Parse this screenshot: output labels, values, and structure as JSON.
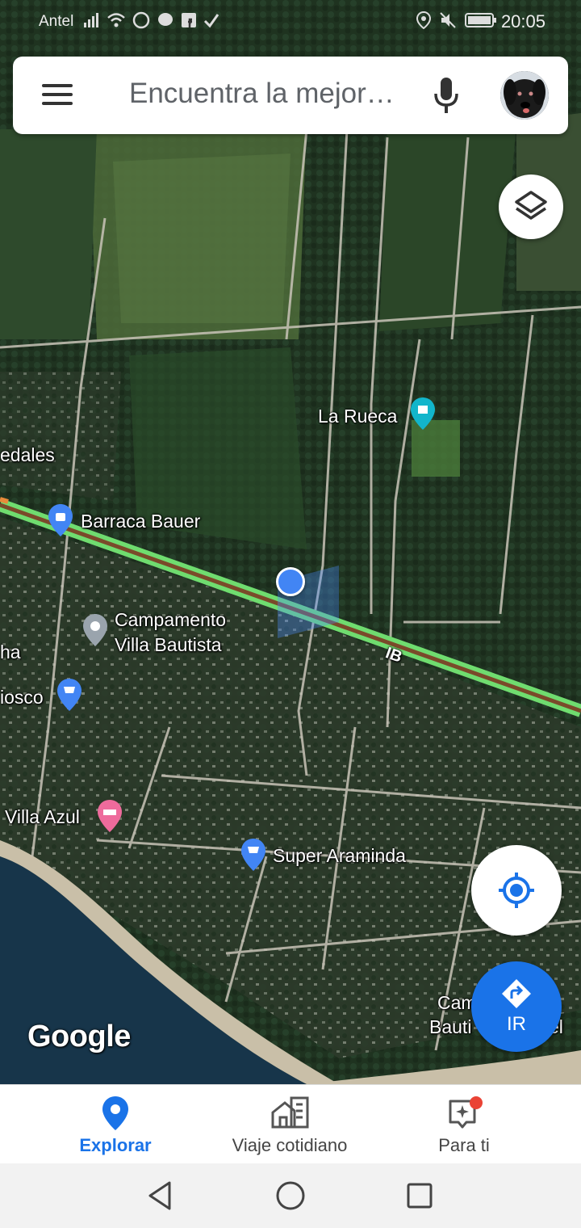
{
  "status_bar": {
    "carrier": "Antel",
    "time": "20:05",
    "icons_left": [
      "signal-icon",
      "wifi-icon",
      "whatsapp-icon",
      "messenger-icon",
      "facebook-icon",
      "check-icon"
    ],
    "icons_right": [
      "location-icon",
      "mute-icon",
      "battery-icon"
    ]
  },
  "search": {
    "placeholder": "Encuentra la mejor…"
  },
  "map": {
    "road_label": "IB",
    "places": [
      {
        "name": "La Rueca"
      },
      {
        "name": "edales"
      },
      {
        "name": "Barraca Bauer"
      },
      {
        "name": "Campamento\nVilla Bautista"
      },
      {
        "name": "ha"
      },
      {
        "name": "iosco"
      },
      {
        "name": "Villa Azul"
      },
      {
        "name": "Super Araminda"
      },
      {
        "name": "Cam"
      },
      {
        "name": "Bauti"
      },
      {
        "name": "el"
      }
    ],
    "watermark": "Google"
  },
  "buttons": {
    "go_label": "IR"
  },
  "bottom_nav": {
    "items": [
      {
        "label": "Explorar",
        "icon": "explore-pin-icon",
        "active": true
      },
      {
        "label": "Viaje cotidiano",
        "icon": "commute-icon",
        "active": false
      },
      {
        "label": "Para ti",
        "icon": "for-you-icon",
        "active": false
      }
    ]
  },
  "colors": {
    "accent": "#1a73e8",
    "route_green": "#6fdc6f",
    "notification": "#ea4335"
  }
}
